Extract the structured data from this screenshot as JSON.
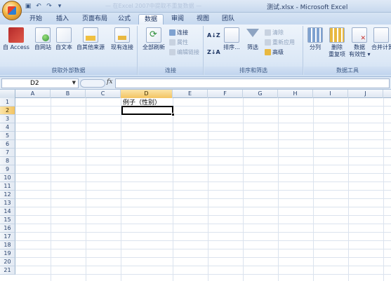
{
  "window": {
    "title": "测试.xlsx - Microsoft Excel",
    "ghost_title": "— 在Excel 2007中提取不重复数据 —"
  },
  "quick_access": [
    "save-icon",
    "undo-icon",
    "redo-icon",
    "customize-icon"
  ],
  "tabs": [
    {
      "label": "开始"
    },
    {
      "label": "插入"
    },
    {
      "label": "页面布局"
    },
    {
      "label": "公式"
    },
    {
      "label": "数据"
    },
    {
      "label": "审阅"
    },
    {
      "label": "视图"
    },
    {
      "label": "团队"
    }
  ],
  "active_tab": "数据",
  "ribbon": {
    "get_external": {
      "label": "获取外部数据",
      "buttons": [
        "自 Access",
        "自网站",
        "自文本",
        "自其他来源",
        "现有连接"
      ]
    },
    "connections": {
      "label": "连接",
      "refresh_all": "全部刷新",
      "connections": "连接",
      "properties": "属性",
      "edit_links": "编辑链接"
    },
    "sort_filter": {
      "label": "排序和筛选",
      "sort": "排序...",
      "filter": "筛选",
      "clear": "清除",
      "reapply": "重新应用",
      "advanced": "高级"
    },
    "data_tools": {
      "label": "数据工具",
      "split": "分列",
      "remove_dup_1": "删除",
      "remove_dup_2": "重复项",
      "validation_1": "数据",
      "validation_2": "有效性 ▾",
      "consolidate": "合并计算"
    }
  },
  "formula_bar": {
    "name_box": "D2",
    "fx": "fx",
    "formula": ""
  },
  "sheet": {
    "columns": [
      "A",
      "B",
      "C",
      "D",
      "E",
      "F",
      "G",
      "H",
      "I",
      "J"
    ],
    "rows": [
      "1",
      "2",
      "3",
      "4",
      "5",
      "6",
      "7",
      "8",
      "9",
      "10",
      "11",
      "12",
      "13",
      "14",
      "15",
      "16",
      "17",
      "18",
      "19",
      "20",
      "21"
    ],
    "selected_column": "D",
    "selected_row": "2",
    "cells": {
      "D1": "例子（性别）"
    }
  }
}
